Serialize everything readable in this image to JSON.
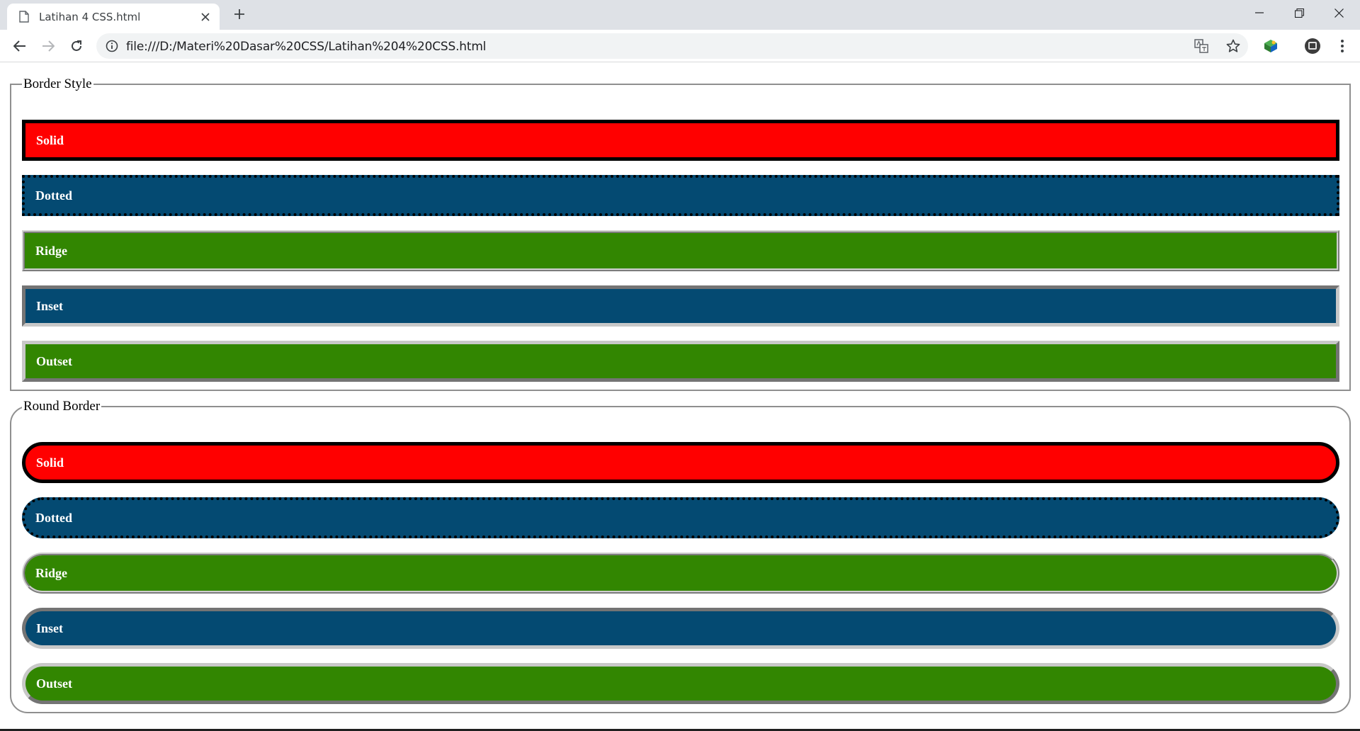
{
  "browser": {
    "tab_title": "Latihan 4 CSS.html",
    "url": "file:///D:/Materi%20Dasar%20CSS/Latihan%204%20CSS.html"
  },
  "sections": [
    {
      "legend": "Border Style",
      "boxes": [
        "Solid",
        "Dotted",
        "Ridge",
        "Inset",
        "Outset"
      ]
    },
    {
      "legend": "Round Border",
      "boxes": [
        "Solid",
        "Dotted",
        "Ridge",
        "Inset",
        "Outset"
      ]
    }
  ],
  "colors": {
    "red": "#ff0000",
    "blue": "#044a72",
    "green": "#328601",
    "tabstrip": "#dee1e6"
  }
}
